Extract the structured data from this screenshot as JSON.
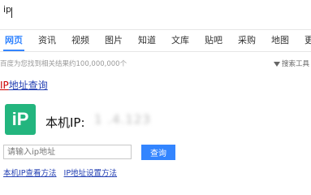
{
  "search": {
    "query": "ip"
  },
  "tabs": [
    "网页",
    "资讯",
    "视频",
    "图片",
    "知道",
    "文库",
    "贴吧",
    "采购",
    "地图",
    "更"
  ],
  "result_count": "百度为您找到相关结果约100,000,000个",
  "search_tools": "搜索工具",
  "result": {
    "title_highlight": "IP",
    "title_rest": "地址查询"
  },
  "ip_card": {
    "logo_text": "iP",
    "label": "本机IP:",
    "value": "1 .4.123 ",
    "input_placeholder": "请输入ip地址",
    "button_label": "查询",
    "link1": "本机IP查看方法",
    "link2": "IP地址设置方法"
  },
  "colors": {
    "accent": "#3385ff",
    "logo_bg": "#23b57e",
    "link": "#2440b3",
    "highlight": "#cc0000"
  }
}
